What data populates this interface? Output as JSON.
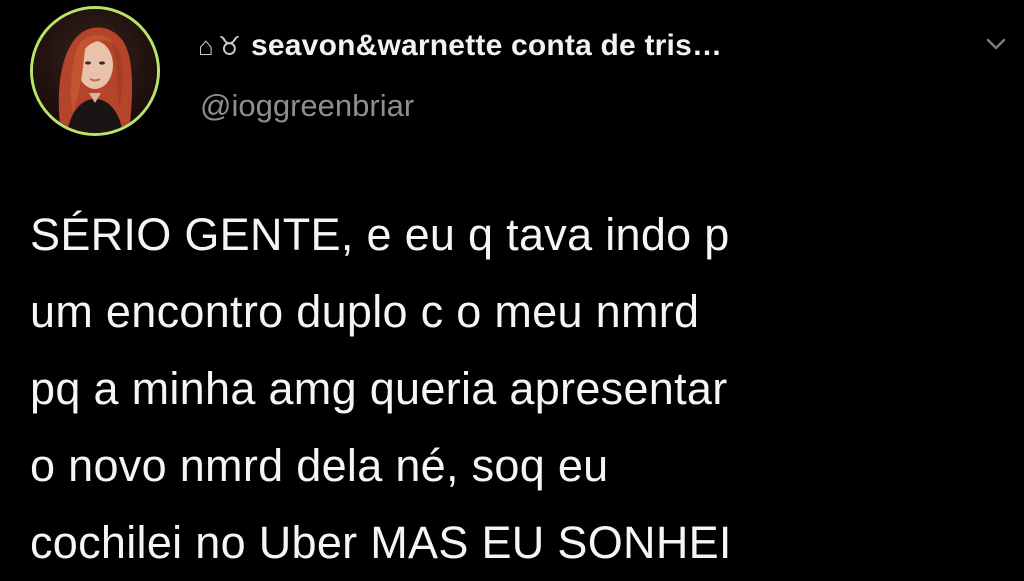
{
  "tweet": {
    "display_name": "seavon&warnette conta de tris…",
    "name_icons": [
      "house-icon",
      "taurus-icon"
    ],
    "name_glyphs": [
      "⌂",
      "♉"
    ],
    "handle": "@ioggreenbriar",
    "avatar_ring_color": "#b9e36a",
    "body_lines": [
      "SÉRIO GENTE, e eu q tava indo p",
      "um encontro duplo c o meu nmrd",
      "pq a minha amg queria apresentar",
      "o novo nmrd dela né, soq eu",
      "cochilei no Uber MAS EU SONHEI"
    ]
  },
  "colors": {
    "background": "#000000",
    "text": "#f5f5f5",
    "secondary_text": "#8b8f93"
  }
}
